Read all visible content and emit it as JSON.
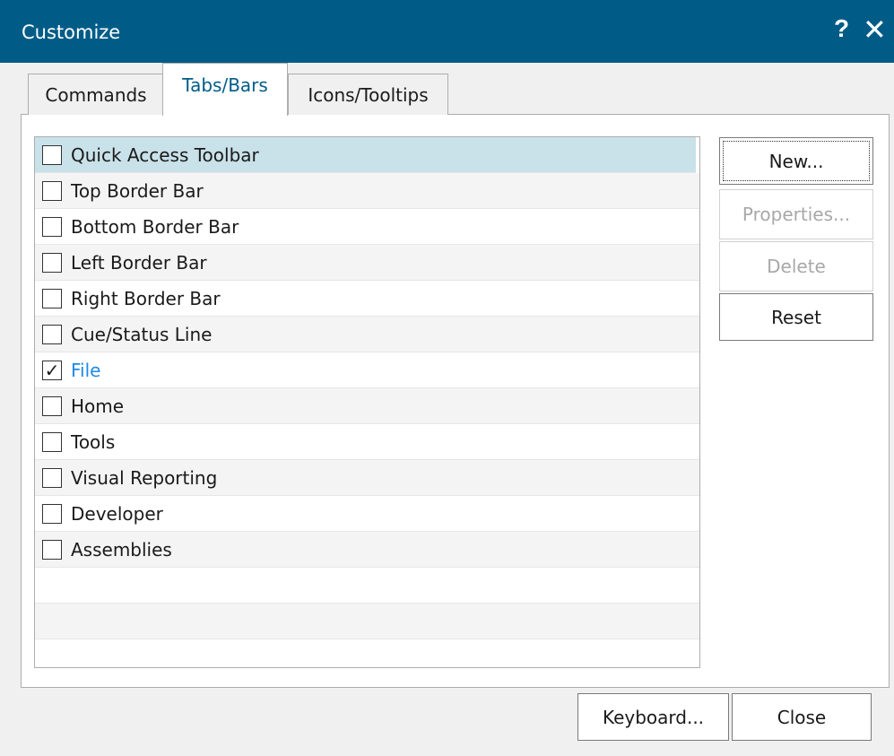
{
  "window": {
    "title": "Customize",
    "help_glyph": "?",
    "close_glyph": "✕"
  },
  "tabs": [
    {
      "label": "Commands",
      "active": false
    },
    {
      "label": "Tabs/Bars",
      "active": true
    },
    {
      "label": "Icons/Tooltips",
      "active": false
    }
  ],
  "list": {
    "items": [
      {
        "label": "Quick Access Toolbar",
        "checked": false,
        "selected": true
      },
      {
        "label": "Top Border Bar",
        "checked": false
      },
      {
        "label": "Bottom Border Bar",
        "checked": false
      },
      {
        "label": "Left Border Bar",
        "checked": false
      },
      {
        "label": "Right Border Bar",
        "checked": false
      },
      {
        "label": "Cue/Status Line",
        "checked": false
      },
      {
        "label": "File",
        "checked": true
      },
      {
        "label": "Home",
        "checked": false
      },
      {
        "label": "Tools",
        "checked": false
      },
      {
        "label": "Visual Reporting",
        "checked": false
      },
      {
        "label": "Developer",
        "checked": false
      },
      {
        "label": "Assemblies",
        "checked": false
      }
    ],
    "check_glyph": "✓"
  },
  "side_buttons": {
    "new": "New...",
    "properties": "Properties...",
    "delete": "Delete",
    "reset": "Reset"
  },
  "footer": {
    "keyboard": "Keyboard...",
    "close": "Close"
  },
  "colors": {
    "titlebar": "#005c87",
    "selected_row": "#c9e1e9",
    "checked_label": "#1e8ae6"
  }
}
